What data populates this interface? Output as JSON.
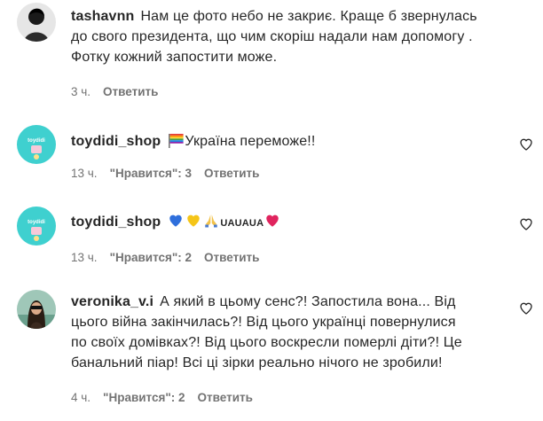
{
  "comments": [
    {
      "username": "tashavnn",
      "text_lines": [
        "Нам це фото небо не закриє. Краще б звернулась",
        "до свого президента, що чим скоріш надали нам допомогу .",
        "Фотку кожний запостити може."
      ],
      "time": "3 ч.",
      "likes": "",
      "reply_label": "Ответить",
      "show_like_icon": false
    },
    {
      "username": "toydidi_shop",
      "emoji_prefix": [
        "rainbow-flag"
      ],
      "text_lines": [
        "Україна переможе!!"
      ],
      "time": "13 ч.",
      "likes": "\"Нравится\": 3",
      "reply_label": "Ответить",
      "show_like_icon": true
    },
    {
      "username": "toydidi_shop",
      "emoji_prefix": [
        "blue-heart",
        "yellow-heart",
        "folded-hands"
      ],
      "emoji_text": "UAUAUA",
      "emoji_suffix": [
        "red-heart"
      ],
      "text_lines": [],
      "time": "13 ч.",
      "likes": "\"Нравится\": 2",
      "reply_label": "Ответить",
      "show_like_icon": true
    },
    {
      "username": "veronika_v.i",
      "text_lines": [
        "А який в цьому сенс?! Запостила вона... Від",
        "цього війна закінчилась?! Від цього українці повернулися",
        "по своїх домівках?! Від цього воскресли померлі діти?! Це",
        "банальний піар! Всі ці зірки реально нічого не зробили!"
      ],
      "time": "4 ч.",
      "likes": "\"Нравится\": 2",
      "reply_label": "Ответить",
      "show_like_icon": true
    }
  ],
  "colors": {
    "text": "#262626",
    "meta": "#737373",
    "blue_heart": "#2f6fdc",
    "yellow_heart": "#f5c518",
    "red_heart": "#e0245e"
  },
  "icons": {
    "like": "heart-outline-icon"
  }
}
